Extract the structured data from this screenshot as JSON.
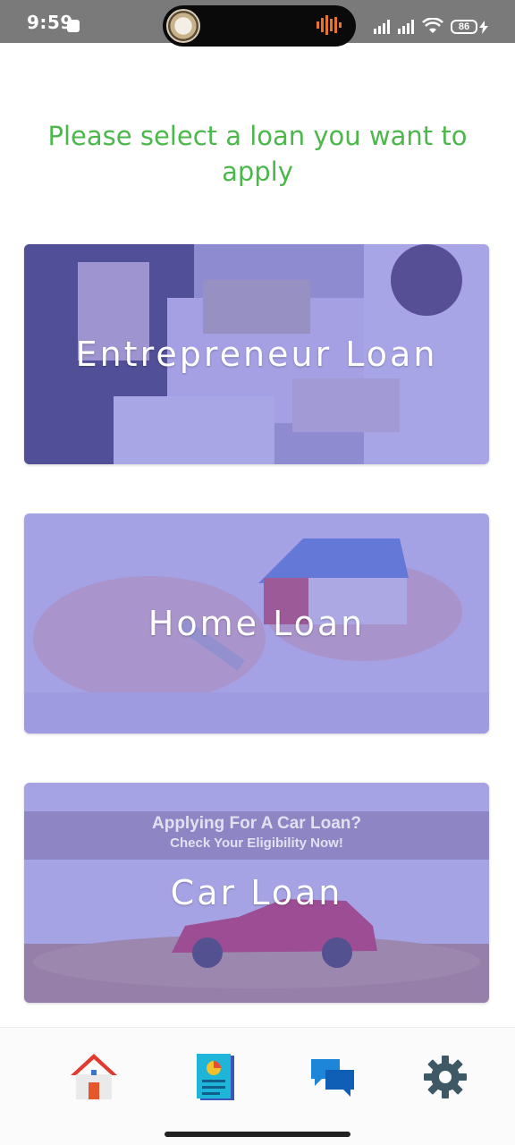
{
  "status_bar": {
    "time": "9:59",
    "battery": "86"
  },
  "heading": "Please select a loan you want to apply",
  "loans": [
    {
      "label": "Entrepreneur Loan"
    },
    {
      "label": "Home Loan"
    },
    {
      "label": "Car Loan",
      "banner_line1": "Applying For A Car Loan?",
      "banner_line2": "Check Your Eligibility Now!"
    }
  ],
  "bottom_nav": {
    "items": [
      {
        "icon": "home-icon"
      },
      {
        "icon": "report-icon"
      },
      {
        "icon": "chat-icon"
      },
      {
        "icon": "gear-icon"
      }
    ]
  },
  "colors": {
    "heading": "#4cb84c",
    "card_overlay": "#6e69dc"
  }
}
